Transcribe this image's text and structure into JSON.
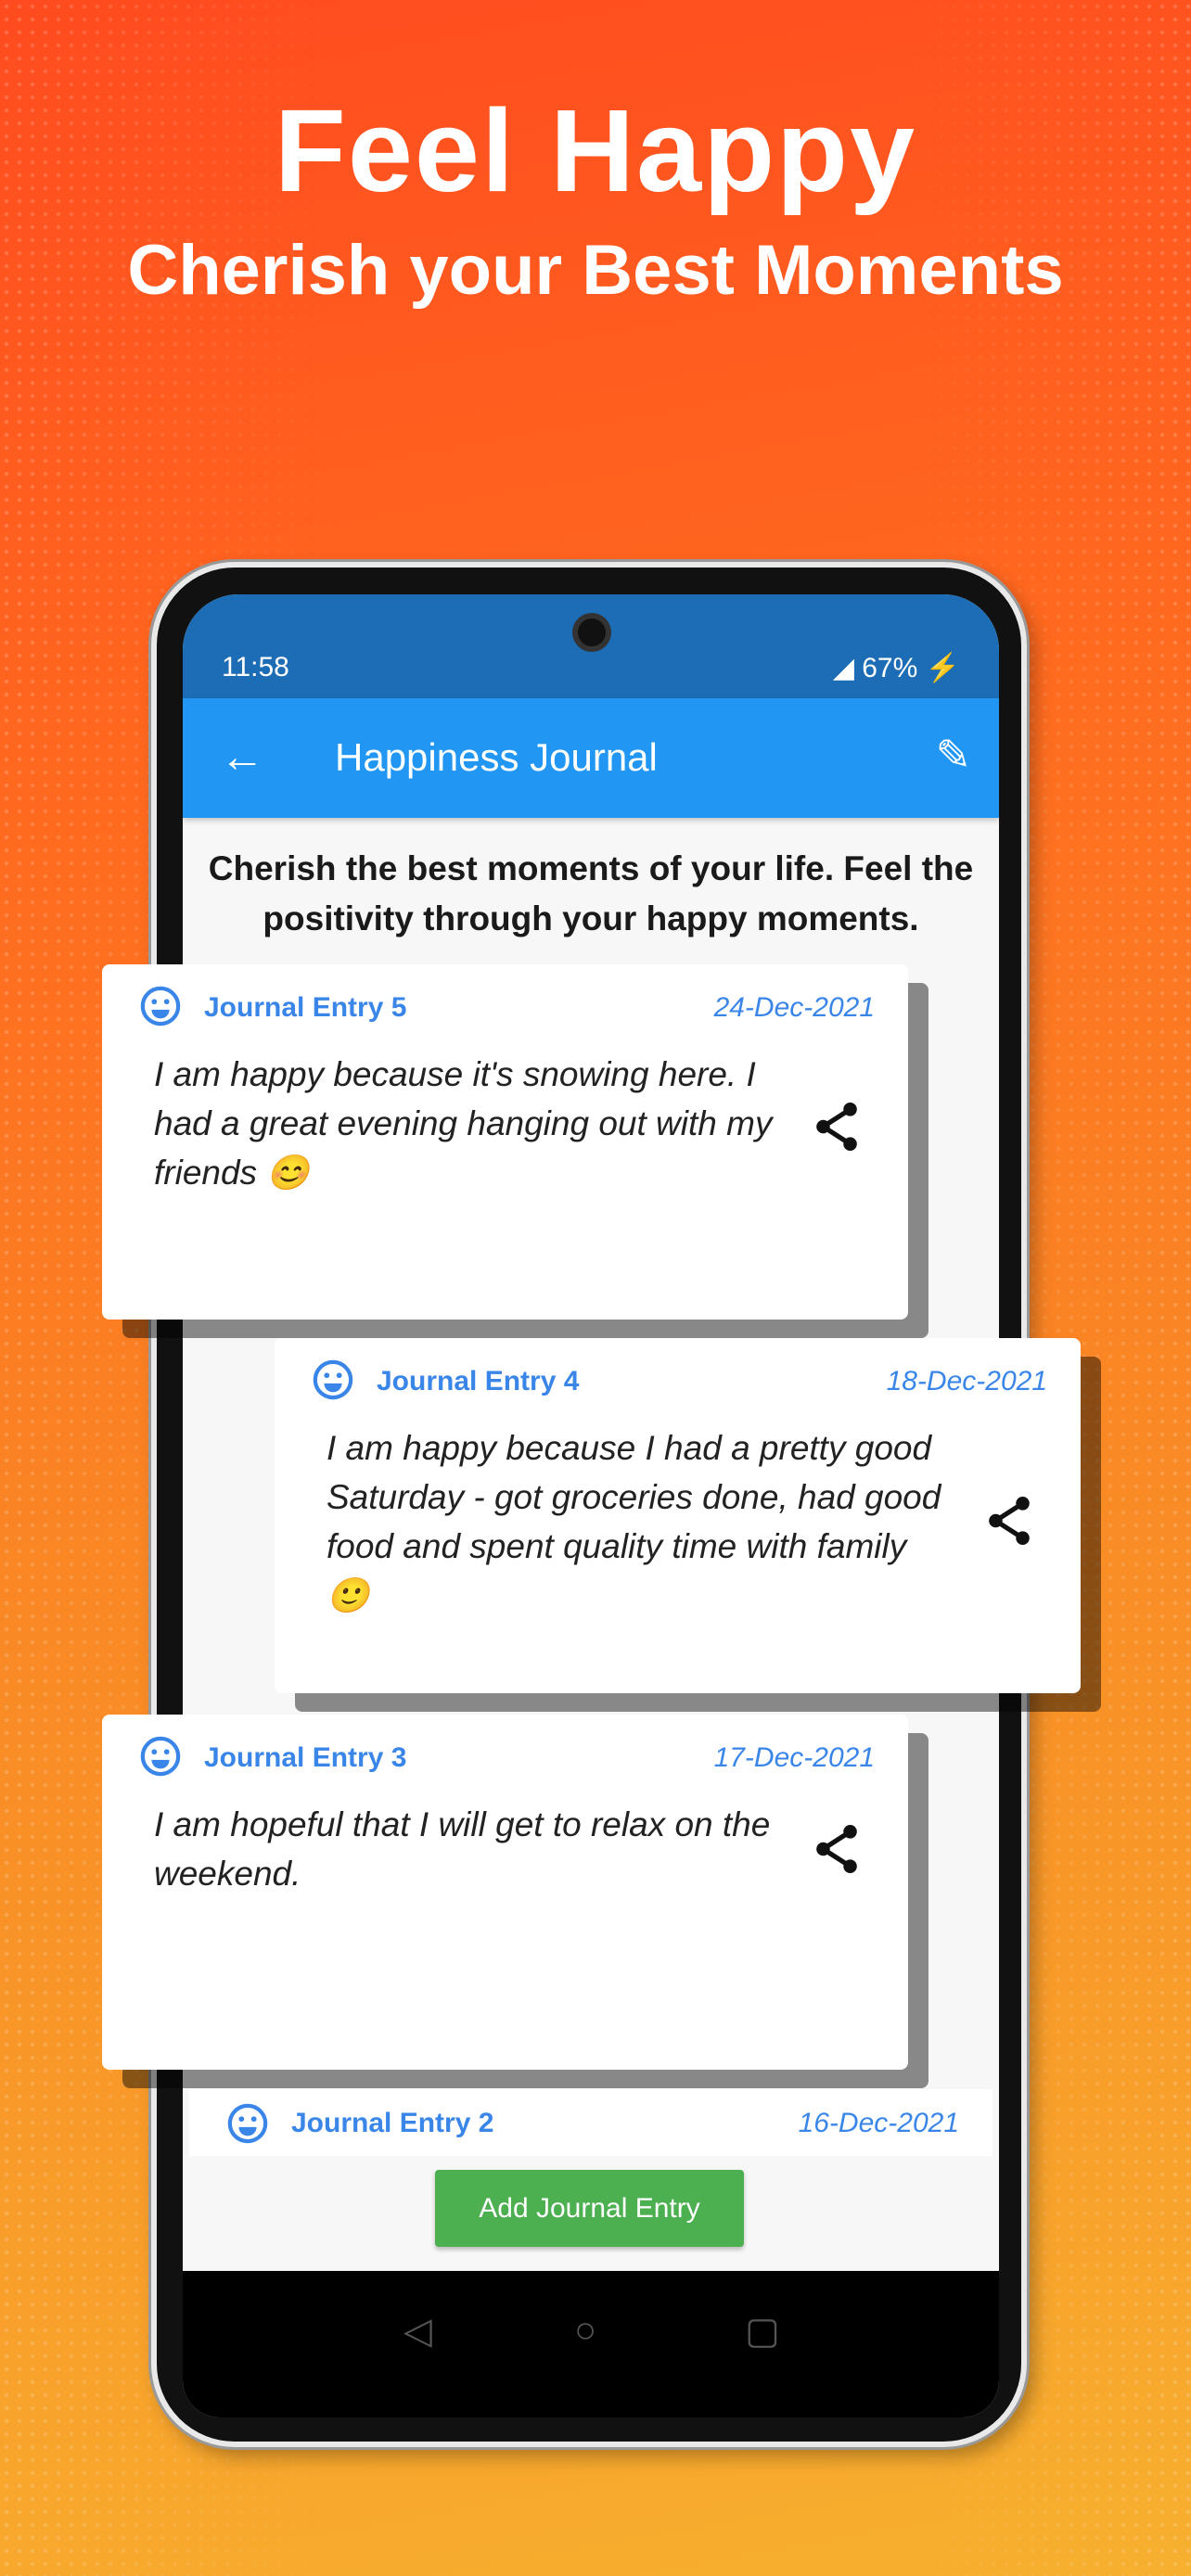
{
  "promo": {
    "title": "Feel Happy",
    "subtitle": "Cherish your Best Moments"
  },
  "status_bar": {
    "time": "11:58",
    "battery": "67%"
  },
  "app_bar": {
    "title": "Happiness Journal",
    "back_icon": "arrow-left",
    "edit_icon": "pencil"
  },
  "intro": "Cherish the best moments of your life. Feel the positivity through your happy moments.",
  "entries": [
    {
      "name": "Journal Entry 5",
      "date": "24-Dec-2021",
      "text": "I am happy because it's snowing here. I had a great evening hanging out with my friends 😊"
    },
    {
      "name": "Journal Entry 4",
      "date": "18-Dec-2021",
      "text": "I am happy because I had a pretty good Saturday - got groceries done, had good food and spent quality time with family 🙂"
    },
    {
      "name": "Journal Entry 3",
      "date": "17-Dec-2021",
      "text": "I am hopeful that I will get to relax on the weekend."
    },
    {
      "name": "Journal Entry 2",
      "date": "16-Dec-2021"
    }
  ],
  "add_button": "Add Journal Entry",
  "colors": {
    "status_bar": "#1c6db5",
    "app_bar": "#2196f3",
    "accent": "#3a86e8",
    "button": "#4caf50"
  }
}
